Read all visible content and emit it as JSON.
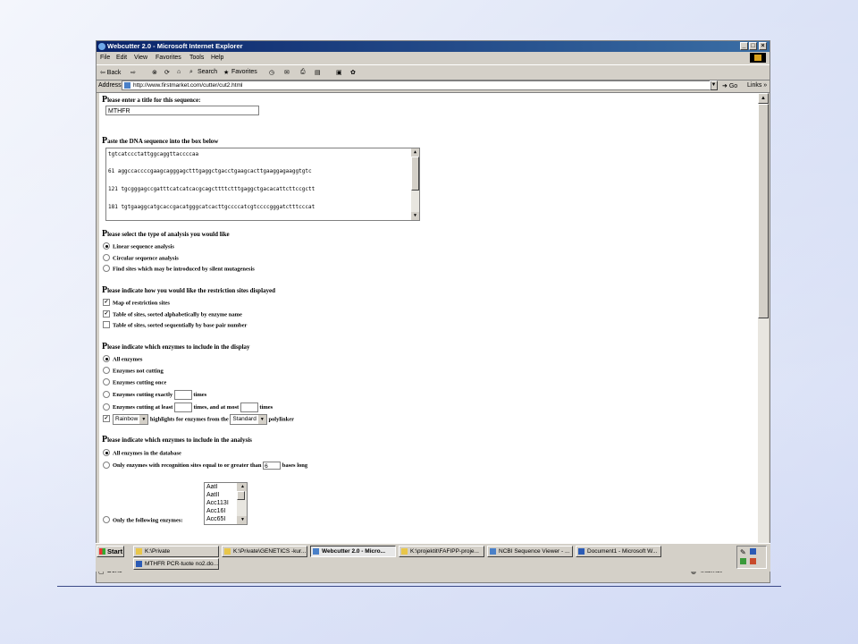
{
  "window": {
    "title": "Webcutter 2.0 - Microsoft Internet Explorer",
    "controls": [
      "_",
      "□",
      "×"
    ]
  },
  "menu": [
    "File",
    "Edit",
    "View",
    "Favorites",
    "Tools",
    "Help"
  ],
  "toolbar": {
    "back": "⇦ Back",
    "forward": "⇨",
    "search": "Search",
    "favorites": "Favorites"
  },
  "address": {
    "label": "Address",
    "url": "http://www.firstmarket.com/cutter/cut2.html",
    "go": "Go",
    "links": "Links »"
  },
  "form": {
    "q_title": {
      "cap": "P",
      "rest": "lease enter a title for this sequence:"
    },
    "title_value": "MTHFR",
    "q_sequence": {
      "cap": "P",
      "rest": "aste the DNA sequence into the box below"
    },
    "sequence_lines": [
      "tgtcatccctattggcaggttaccccaa",
      "61 aggccaccccgaagcagggagctttgaggctgacctgaagcacttgaaggagaaggtgtc",
      "121 tgcgggagccgatttcatcatcacgcagcttttctttgaggctgacacattcttccgctt",
      "181 tgtgaaggcatgcaccgacatgggcatcacttgccccatcgtccccgggatctttcccat"
    ],
    "q_analysis": {
      "cap": "P",
      "rest": "lease select the type of analysis you would like"
    },
    "analysis_options": [
      {
        "label": "Linear sequence analysis",
        "checked": true
      },
      {
        "label": "Circular sequence analysis",
        "checked": false
      },
      {
        "label": "Find sites which may be introduced by silent mutagenesis",
        "checked": false
      }
    ],
    "q_display": {
      "cap": "P",
      "rest": "lease indicate how you would like the restriction sites displayed"
    },
    "display_options": [
      {
        "label": "Map of restriction sites",
        "checked": true
      },
      {
        "label": "Table of sites, sorted alphabetically by enzyme name",
        "checked": true
      },
      {
        "label": "Table of sites, sorted sequentially by base pair number",
        "checked": false
      }
    ],
    "q_enzymes_display": {
      "cap": "P",
      "rest": "lease indicate which enzymes to include in the display"
    },
    "enzyme_display_options": {
      "all": "All enzymes",
      "not_cutting": "Enzymes not cutting",
      "once": "Enzymes cutting once",
      "exactly": "Enzymes cutting exactly",
      "times": "times",
      "at_least": "Enzymes cutting at least",
      "and_at_most": "times, and at most",
      "times2": "times"
    },
    "highlight": {
      "color": "Rainbow",
      "mid": "highlights for enzymes from the",
      "polylinker": "Standard",
      "end": "polylinker"
    },
    "q_enzymes_analysis": {
      "cap": "P",
      "rest": "lease indicate which enzymes to include in the analysis"
    },
    "analysis_enzyme_options": {
      "all": "All enzymes in the database",
      "recognition": "Only enzymes with recognition sites equal to or greater than",
      "min_bases": "6",
      "bases_long": "bases long",
      "following": "Only the following enzymes:"
    },
    "enzyme_list": [
      "AatI",
      "AatII",
      "Acc113I",
      "Acc16I",
      "Acc65I"
    ]
  },
  "status": {
    "text": "Done",
    "zone": "Internet"
  },
  "taskbar": {
    "start": "Start",
    "row1": [
      {
        "label": "K:\\Private",
        "active": false
      },
      {
        "label": "K:\\Private\\GENETICS -kur...",
        "active": false
      },
      {
        "label": "Webcutter 2.0 - Micro...",
        "active": true
      },
      {
        "label": "K:\\projektit\\FAFIPP-proje...",
        "active": false
      },
      {
        "label": "NCBI Sequence Viewer - ...",
        "active": false
      },
      {
        "label": "Document1 - Microsoft W...",
        "active": false
      }
    ],
    "row2": [
      {
        "label": "MTHFR PCR-tuote no2.do...",
        "active": false
      }
    ]
  }
}
